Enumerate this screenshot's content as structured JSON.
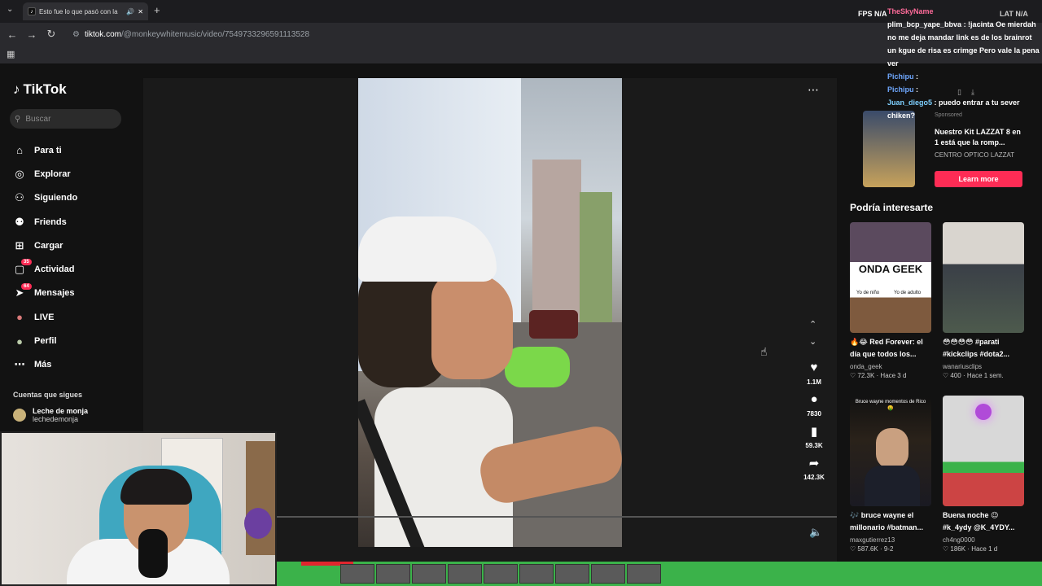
{
  "browser": {
    "tab_title": "Esto fue lo que pasó con la",
    "url_host": "tiktok.com",
    "url_path": "/@monkeywhitemusic/video/7549733296591113528"
  },
  "tiktok": {
    "logo": "TikTok",
    "search_placeholder": "Buscar",
    "menu": [
      {
        "label": "Para ti",
        "icon": "home-icon"
      },
      {
        "label": "Explorar",
        "icon": "compass-icon"
      },
      {
        "label": "Siguiendo",
        "icon": "user-follow-icon"
      },
      {
        "label": "Friends",
        "icon": "friends-icon"
      },
      {
        "label": "Cargar",
        "icon": "upload-icon"
      },
      {
        "label": "Actividad",
        "icon": "activity-icon",
        "badge": "35"
      },
      {
        "label": "Mensajes",
        "icon": "messages-icon",
        "badge": "64"
      },
      {
        "label": "LIVE",
        "icon": "live-icon"
      },
      {
        "label": "Perfil",
        "icon": "profile-icon"
      },
      {
        "label": "Más",
        "icon": "more-icon"
      }
    ],
    "following_header": "Cuentas que sigues",
    "followed_account": {
      "name": "Leche de monja",
      "handle": "lechedemonja"
    }
  },
  "video": {
    "likes": "1.1M",
    "comments": "7830",
    "saves": "59.3K",
    "shares": "142.3K"
  },
  "ad": {
    "sponsored": "Sponsored",
    "title": "Nuestro Kit LAZZAT 8 en 1 está que la romp...",
    "brand": "CENTRO OPTICO LAZZAT",
    "cta": "Learn more"
  },
  "recommendations": {
    "header": "Podría interesarte",
    "items": [
      {
        "caption": "🔥😂 Red Forever: el día que todos los...",
        "user": "onda_geek",
        "stats": "♡ 72.3K · Hace 3 d"
      },
      {
        "caption": "😳😳😳😳 #parati #kickclips #dota2...",
        "user": "wanariusclips",
        "stats": "♡ 400 · Hace 1 sem."
      },
      {
        "caption": "🎶 bruce wayne el millonario #batman...",
        "user": "maxgutierrez13",
        "stats": "♡ 587.6K · 9-2"
      },
      {
        "caption": "Buena noche 😉 #k_4ydy @K_4YDY...",
        "user": "ch4ng0000",
        "stats": "♡ 186K · Hace 1 d"
      }
    ]
  },
  "overlay": {
    "fps": "FPS  N/A",
    "lat": "LAT  N/A",
    "chat": [
      {
        "name": "TheSkyName",
        "text": ""
      },
      {
        "name": "plim_bcp_yape_bbva",
        "text": ": !jacinta Oe mierdah no me deja mandar link es de los brainrot un kgue de risa es crimge Pero vale la pena ver"
      },
      {
        "name": "Pichipu",
        "text": ":"
      },
      {
        "name": "Pichipu",
        "text": ":"
      },
      {
        "name": "Juan_diego5",
        "text": ": puedo entrar a tu sever chiken?"
      }
    ]
  },
  "thumb_texts": {
    "onda_geek": "ONDA GEEK",
    "nino": "Yo de niño",
    "adulto": "Yo de adulto",
    "bruce": "Bruce wayne momentos de Rico 🤑"
  }
}
